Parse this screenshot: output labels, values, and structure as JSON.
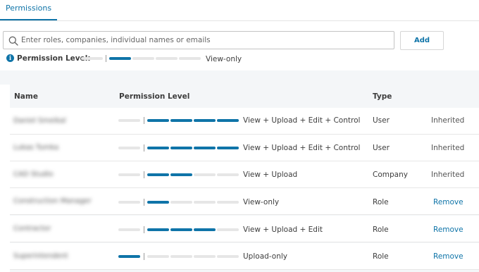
{
  "tabs": {
    "permissions": "Permissions"
  },
  "search": {
    "placeholder": "Enter roles, companies, individual names or emails",
    "value": ""
  },
  "add_button": "Add",
  "permission_level": {
    "label": "Permission Level:",
    "value": "View-only",
    "upload_on": false,
    "filled_levels": 1
  },
  "table": {
    "headers": {
      "name": "Name",
      "permission": "Permission Level",
      "type": "Type"
    },
    "rows": [
      {
        "name": "Daniel Smeikal",
        "permission": "View + Upload + Edit + Control",
        "type": "User",
        "action": "Inherited",
        "upload_on": false,
        "filled_levels": 4
      },
      {
        "name": "Lukas Tumka",
        "permission": "View + Upload + Edit + Control",
        "type": "User",
        "action": "Inherited",
        "upload_on": false,
        "filled_levels": 4
      },
      {
        "name": "CAD Studio",
        "permission": "View + Upload",
        "type": "Company",
        "action": "Inherited",
        "upload_on": false,
        "filled_levels": 2
      },
      {
        "name": "Construction Manager",
        "permission": "View-only",
        "type": "Role",
        "action": "Remove",
        "upload_on": false,
        "filled_levels": 1
      },
      {
        "name": "Contractor",
        "permission": "View + Upload + Edit",
        "type": "Role",
        "action": "Remove",
        "upload_on": false,
        "filled_levels": 3
      },
      {
        "name": "Superintendent",
        "permission": "Upload-only",
        "type": "Role",
        "action": "Remove",
        "upload_on": true,
        "filled_levels": 0
      }
    ]
  },
  "colors": {
    "accent": "#0f74a8",
    "bar_off": "#e6e6e6",
    "table_bg": "#f4f6f8"
  },
  "icons": {
    "search": "search-icon",
    "info": "info-icon"
  }
}
